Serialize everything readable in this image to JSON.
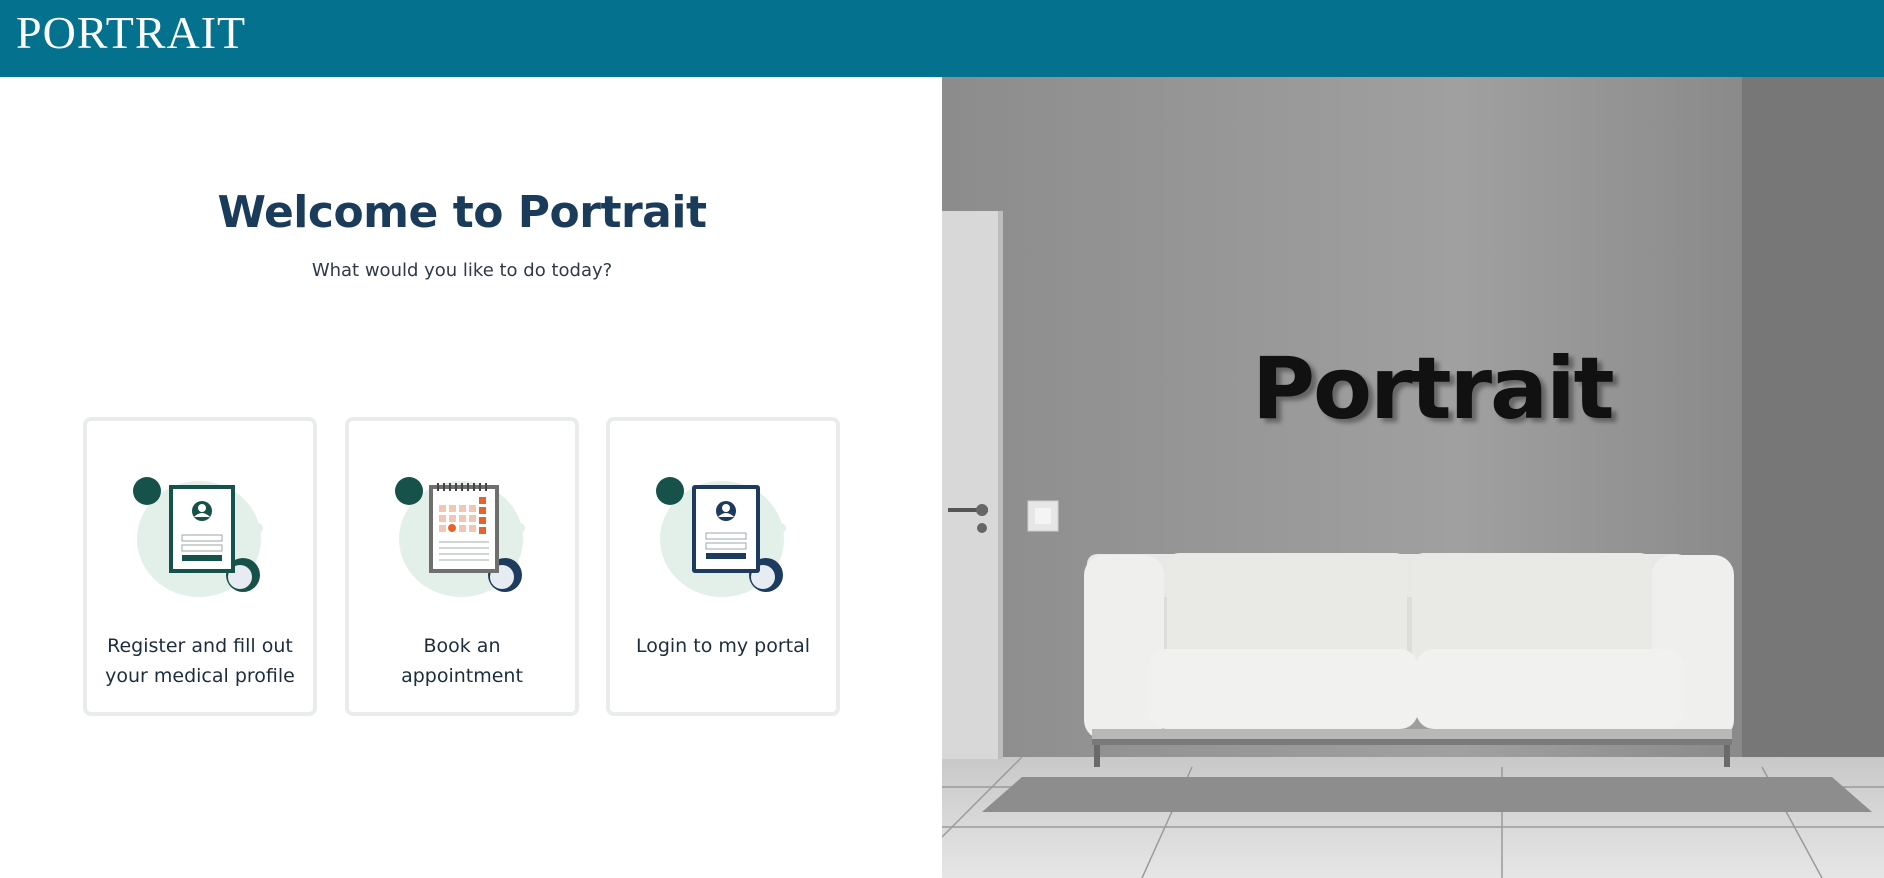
{
  "header": {
    "logo_text": "PORTRAIT",
    "background_color": "#04728f"
  },
  "main": {
    "title": "Welcome to Portrait",
    "subtitle": "What would you like to do today?"
  },
  "cards": [
    {
      "label_line1": "Register and fill out",
      "label_line2": "your medical profile",
      "icon": "register-form-icon",
      "frame_color": "#16524a"
    },
    {
      "label_line1": "Book an",
      "label_line2": "appointment",
      "icon": "calendar-icon",
      "frame_color": "#6f6f6f"
    },
    {
      "label_line1": "Login to my portal",
      "label_line2": "",
      "icon": "login-tablet-icon",
      "frame_color": "#1d3a5f"
    }
  ],
  "hero": {
    "wall_sign_text": "Portrait",
    "scene": "sofa-room-image"
  }
}
